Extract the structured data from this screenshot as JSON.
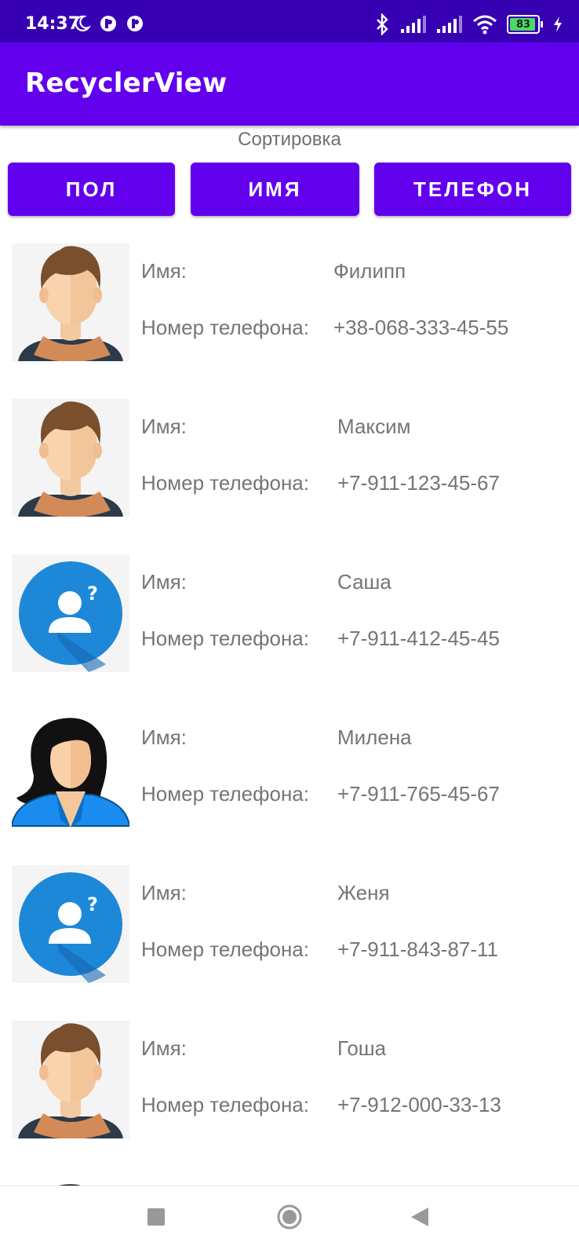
{
  "status_bar": {
    "time": "14:37",
    "battery": "83"
  },
  "app_bar": {
    "title": "RecyclerView"
  },
  "sort": {
    "label": "Сортировка",
    "buttons": [
      "ПОЛ",
      "ИМЯ",
      "ТЕЛЕФОН"
    ]
  },
  "contacts": [
    {
      "name_label": "Имя:",
      "name": "Филипп",
      "phone_label": "Номер телефона:",
      "phone": "+38-068-333-45-55",
      "avatar": "man-avatar"
    },
    {
      "name_label": "Имя:",
      "name": "Максим",
      "phone_label": "Номер телефона:",
      "phone": "+7-911-123-45-67",
      "avatar": "man-avatar"
    },
    {
      "name_label": "Имя:",
      "name": "Саша",
      "phone_label": "Номер телефона:",
      "phone": "+7-911-412-45-45",
      "avatar": "unknown-avatar"
    },
    {
      "name_label": "Имя:",
      "name": "Милена",
      "phone_label": "Номер телефона:",
      "phone": "+7-911-765-45-67",
      "avatar": "woman-avatar"
    },
    {
      "name_label": "Имя:",
      "name": "Женя",
      "phone_label": "Номер телефона:",
      "phone": "+7-911-843-87-11",
      "avatar": "unknown-avatar"
    },
    {
      "name_label": "Имя:",
      "name": "Гоша",
      "phone_label": "Номер телефона:",
      "phone": "+7-912-000-33-13",
      "avatar": "man-avatar"
    }
  ],
  "nav_bar": {
    "icons": [
      "recents-icon",
      "home-icon",
      "back-icon"
    ]
  },
  "colors": {
    "primary": "#6200ee",
    "primary_dark": "#3700b3",
    "text_secondary": "#757575"
  }
}
